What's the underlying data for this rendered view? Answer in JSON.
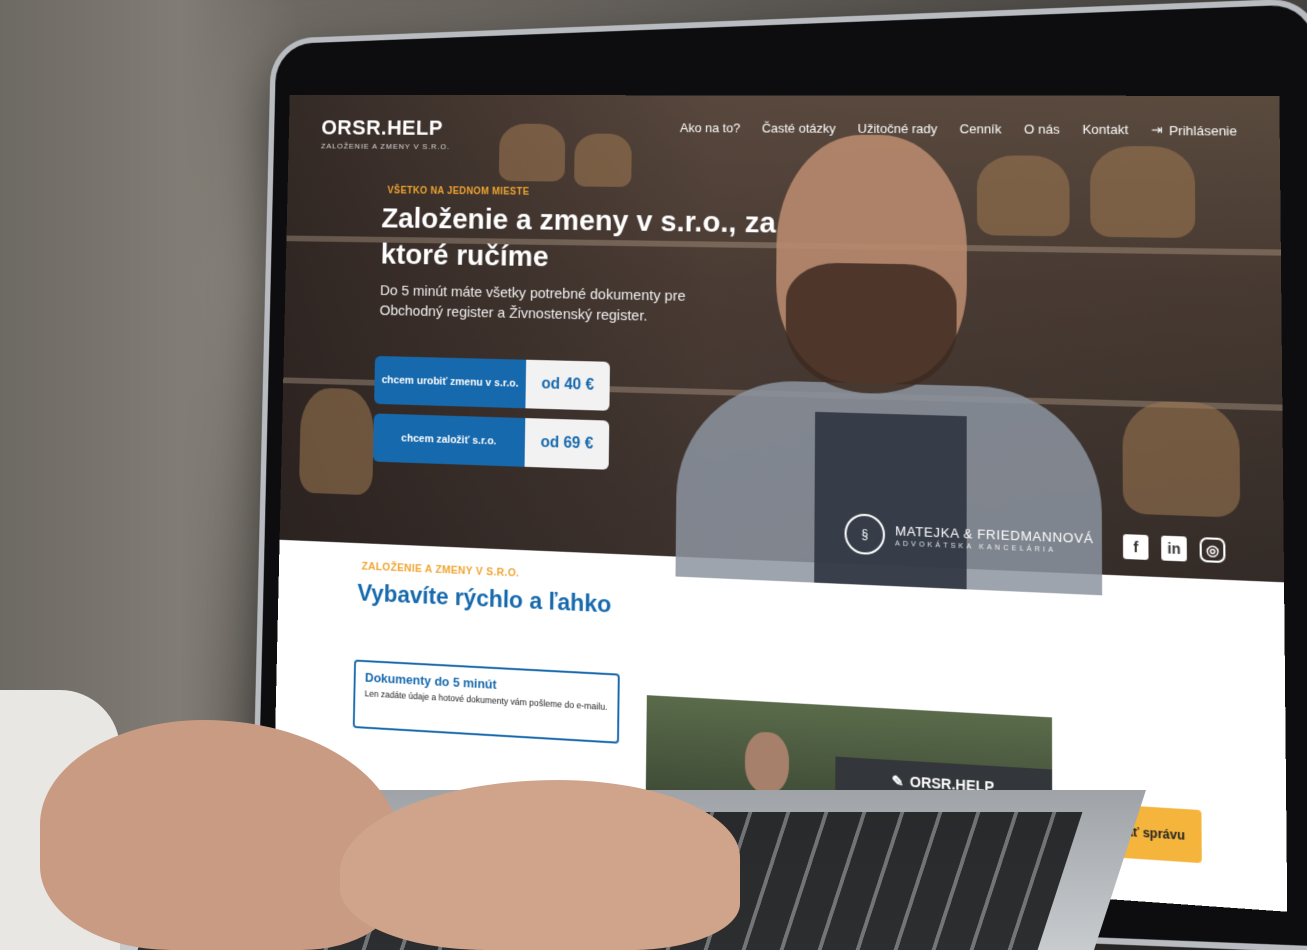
{
  "site": {
    "logo_main": "ORSR.HELP",
    "logo_sub": "ZALOŽENIE A ZMENY V S.R.O."
  },
  "nav": {
    "items": [
      "Ako na to?",
      "Časté otázky",
      "Užitočné rady",
      "Cenník",
      "O nás",
      "Kontakt"
    ],
    "login": "Prihlásenie"
  },
  "hero": {
    "eyebrow": "VŠETKO NA JEDNOM MIESTE",
    "title": "Založenie a zmeny v s.r.o., za ktoré ručíme",
    "subtitle": "Do 5 minút máte všetky potrebné dokumenty pre Obchodný register a Živnostenský register.",
    "cta_change_label": "chcem urobiť zmenu v s.r.o.",
    "cta_change_price": "od 40 €",
    "cta_found_label": "chcem založiť s.r.o.",
    "cta_found_price": "od 69 €"
  },
  "partner": {
    "name": "MATEJKA & FRIEDMANNOVÁ",
    "sub": "ADVOKÁTSKA KANCELÁRIA"
  },
  "socials": {
    "facebook": "f",
    "linkedin": "in",
    "instagram": "◎"
  },
  "section": {
    "eyebrow": "ZALOŽENIE A ZMENY V S.R.O.",
    "title": "Vybavíte rýchlo a ľahko",
    "feature_title": "Dokumenty do 5 minút",
    "feature_text": "Len zadáte údaje a hotové dokumenty vám pošleme do e-mailu."
  },
  "video": {
    "sign": "ORSR.HELP"
  },
  "send_button": "Odoslať správu",
  "colors": {
    "accent_blue": "#1669ad",
    "accent_orange": "#f0a531",
    "send_yellow": "#f5b53d"
  }
}
